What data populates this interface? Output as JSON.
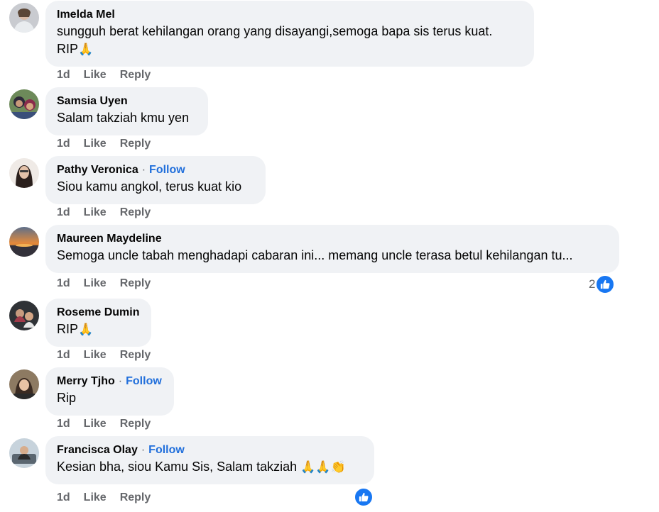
{
  "comments": [
    {
      "name": "Imelda Mel",
      "follow": "",
      "line1": "sungguh berat kehilangan orang yang disayangi,semoga bapa sis terus kuat.",
      "line2": "RIP",
      "line2_emoji": "🙏",
      "time": "1d",
      "like": "Like",
      "reply": "Reply"
    },
    {
      "name": "Samsia Uyen",
      "follow": "",
      "line1": "Salam takziah kmu yen",
      "time": "1d",
      "like": "Like",
      "reply": "Reply"
    },
    {
      "name": "Pathy Veronica",
      "follow": "Follow",
      "line1": "Siou kamu angkol, terus kuat kio",
      "time": "1d",
      "like": "Like",
      "reply": "Reply"
    },
    {
      "name": "Maureen Maydeline",
      "follow": "",
      "line1": "Semoga uncle tabah menghadapi cabaran ini... memang uncle terasa betul kehilangan tu...",
      "time": "1d",
      "like": "Like",
      "reply": "Reply",
      "reaction_count": "2"
    },
    {
      "name": "Roseme Dumin",
      "follow": "",
      "line1": "RIP",
      "line1_emoji": "🙏",
      "time": "1d",
      "like": "Like",
      "reply": "Reply"
    },
    {
      "name": "Merry Tjho",
      "follow": "Follow",
      "line1": "Rip",
      "time": "1d",
      "like": "Like",
      "reply": "Reply"
    },
    {
      "name": "Francisca Olay",
      "follow": "Follow",
      "line1": "Kesian bha, siou Kamu Sis, Salam takziah ",
      "line1_emoji": "🙏🙏👏",
      "time": "1d",
      "like": "Like",
      "reply": "Reply",
      "reaction_count": ""
    }
  ],
  "icons": {
    "reaction": "like-thumb-icon"
  },
  "colors": {
    "bubble": "#f0f2f5",
    "follow": "#216fdb",
    "meta": "#65676b",
    "like_badge": "#1877f2"
  }
}
